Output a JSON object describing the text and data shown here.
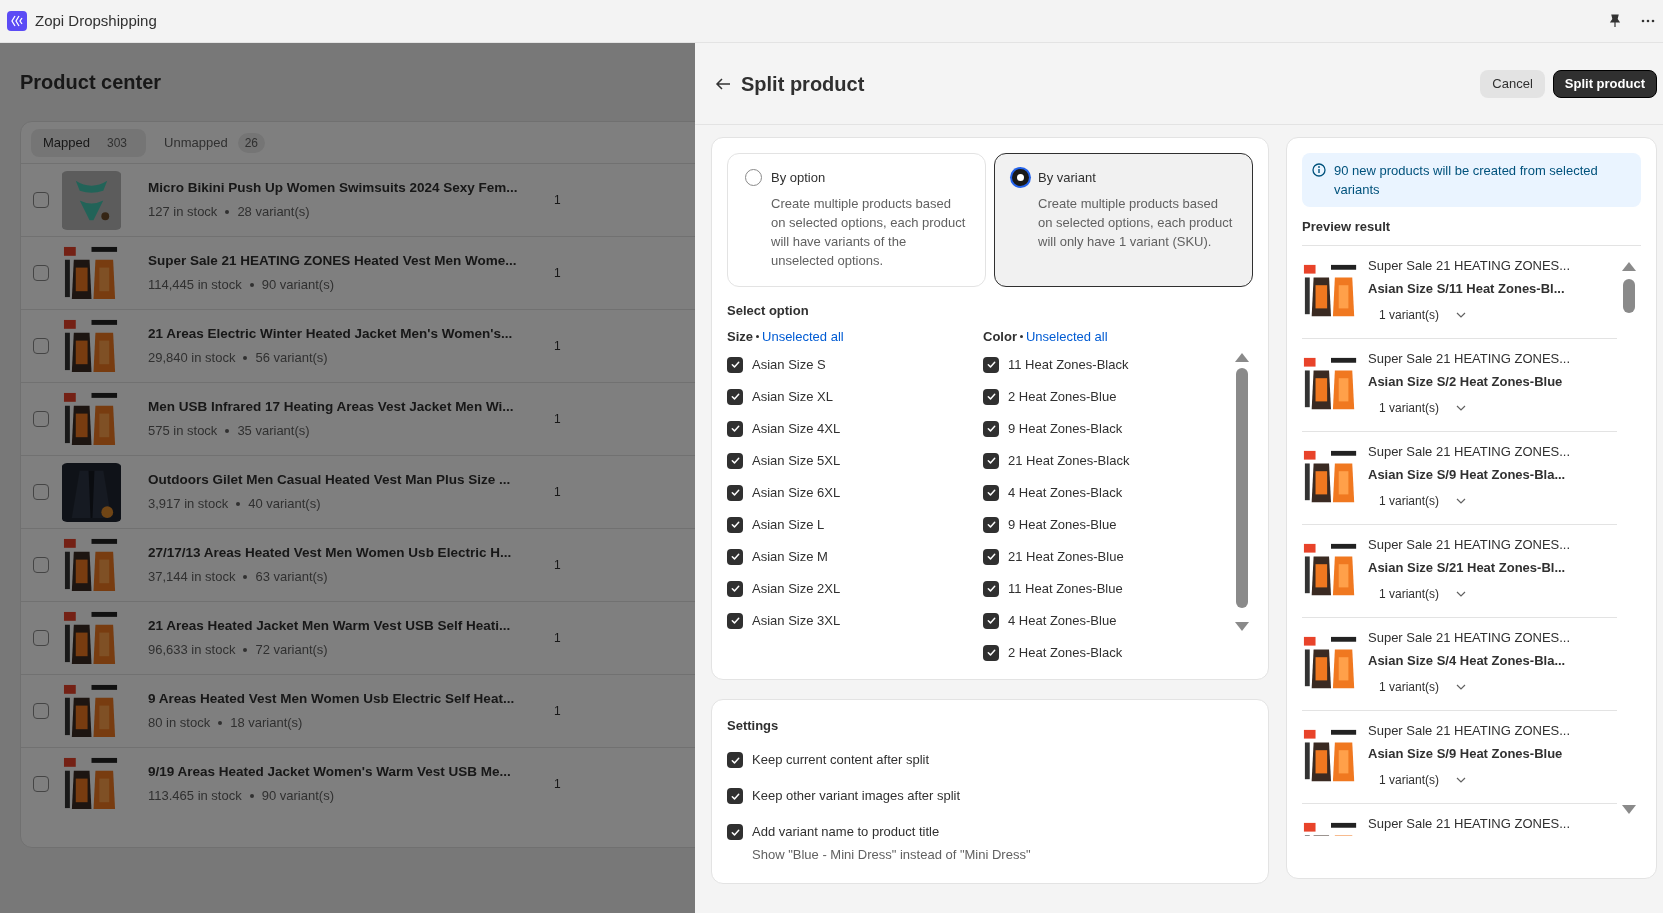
{
  "window": {
    "title": "Zopi Dropshipping"
  },
  "page": {
    "title": "Product center",
    "tabs": [
      {
        "label": "Mapped",
        "count": "303",
        "selected": true
      },
      {
        "label": "Unmapped",
        "count": "26",
        "selected": false
      }
    ],
    "products": [
      {
        "title": "Micro Bikini Push Up Women Swimsuits 2024 Sexy Fem...",
        "stock": "127 in stock",
        "variants": "28 variant(s)",
        "qty": "1",
        "checked": false
      },
      {
        "title": "Super Sale 21 HEATING ZONES Heated Vest Men Wome...",
        "stock": "114,445 in stock",
        "variants": "90 variant(s)",
        "qty": "1",
        "checked": false
      },
      {
        "title": "21 Areas Electric Winter Heated Jacket Men's Women's...",
        "stock": "29,840 in stock",
        "variants": "56 variant(s)",
        "qty": "1",
        "checked": false
      },
      {
        "title": "Men USB Infrared 17 Heating Areas Vest Jacket Men Wi...",
        "stock": "575 in stock",
        "variants": "35 variant(s)",
        "qty": "1",
        "checked": false
      },
      {
        "title": "Outdoors Gilet Men Casual Heated Vest Man Plus Size ...",
        "stock": "3,917 in stock",
        "variants": "40 variant(s)",
        "qty": "1",
        "checked": false
      },
      {
        "title": "27/17/13 Areas Heated Vest Men Women Usb Electric H...",
        "stock": "37,144 in stock",
        "variants": "63 variant(s)",
        "qty": "1",
        "checked": false
      },
      {
        "title": "21 Areas Heated Jacket Men Warm Vest USB Self Heati...",
        "stock": "96,633 in stock",
        "variants": "72 variant(s)",
        "qty": "1",
        "checked": false
      },
      {
        "title": "9 Areas Heated Vest Men Women Usb Electric Self Heat...",
        "stock": "80 in stock",
        "variants": "18 variant(s)",
        "qty": "1",
        "checked": false
      },
      {
        "title": "9/19 Areas Heated Jacket Women's Warm Vest USB Me...",
        "stock": "113.465 in stock",
        "variants": "90 variant(s)",
        "qty": "1",
        "checked": false
      }
    ]
  },
  "drawer": {
    "title": "Split product",
    "cancel": "Cancel",
    "submit": "Split product",
    "modes": [
      {
        "title": "By option",
        "description": "Create multiple products based on selected options, each product will have variants of the unselected options.",
        "selected": false
      },
      {
        "title": "By variant",
        "description": "Create multiple products based on selected options, each product will only have 1 variant (SKU).",
        "selected": true
      }
    ],
    "select_heading": "Select option",
    "option_groups": [
      {
        "name": "Size",
        "action": "Unselected all",
        "values": [
          {
            "label": "Asian Size S",
            "checked": true
          },
          {
            "label": "Asian Size XL",
            "checked": true
          },
          {
            "label": "Asian Size 4XL",
            "checked": true
          },
          {
            "label": "Asian Size 5XL",
            "checked": true
          },
          {
            "label": "Asian Size 6XL",
            "checked": true
          },
          {
            "label": "Asian Size L",
            "checked": true
          },
          {
            "label": "Asian Size M",
            "checked": true
          },
          {
            "label": "Asian Size 2XL",
            "checked": true
          },
          {
            "label": "Asian Size 3XL",
            "checked": true
          }
        ]
      },
      {
        "name": "Color",
        "action": "Unselected all",
        "values": [
          {
            "label": "11 Heat Zones-Black",
            "checked": true
          },
          {
            "label": "2 Heat Zones-Blue",
            "checked": true
          },
          {
            "label": "9 Heat Zones-Black",
            "checked": true
          },
          {
            "label": "21 Heat Zones-Black",
            "checked": true
          },
          {
            "label": "4 Heat Zones-Black",
            "checked": true
          },
          {
            "label": "9 Heat Zones-Blue",
            "checked": true
          },
          {
            "label": "21 Heat Zones-Blue",
            "checked": true
          },
          {
            "label": "11 Heat Zones-Blue",
            "checked": true
          },
          {
            "label": "4 Heat Zones-Blue",
            "checked": true
          },
          {
            "label": "2 Heat Zones-Black",
            "checked": true
          }
        ]
      }
    ],
    "settings": {
      "heading": "Settings",
      "items": [
        {
          "label": "Keep current content after split",
          "checked": true
        },
        {
          "label": "Keep other variant images after split",
          "checked": true
        },
        {
          "label": "Add variant name to product title",
          "checked": true,
          "hint": "Show \"Blue - Mini Dress\" instead of \"Mini Dress\""
        }
      ]
    },
    "notice": "90 new products will be created from selected variants",
    "preview_heading": "Preview result",
    "preview": [
      {
        "title": "Super Sale 21 HEATING ZONES...",
        "variant": "Asian Size S/11 Heat Zones-Bl...",
        "count": "1 variant(s)"
      },
      {
        "title": "Super Sale 21 HEATING ZONES...",
        "variant": "Asian Size S/2 Heat Zones-Blue",
        "count": "1 variant(s)"
      },
      {
        "title": "Super Sale 21 HEATING ZONES...",
        "variant": "Asian Size S/9 Heat Zones-Bla...",
        "count": "1 variant(s)"
      },
      {
        "title": "Super Sale 21 HEATING ZONES...",
        "variant": "Asian Size S/21 Heat Zones-Bl...",
        "count": "1 variant(s)"
      },
      {
        "title": "Super Sale 21 HEATING ZONES...",
        "variant": "Asian Size S/4 Heat Zones-Bla...",
        "count": "1 variant(s)"
      },
      {
        "title": "Super Sale 21 HEATING ZONES...",
        "variant": "Asian Size S/9 Heat Zones-Blue",
        "count": "1 variant(s)"
      },
      {
        "title": "Super Sale 21 HEATING ZONES..."
      }
    ]
  }
}
